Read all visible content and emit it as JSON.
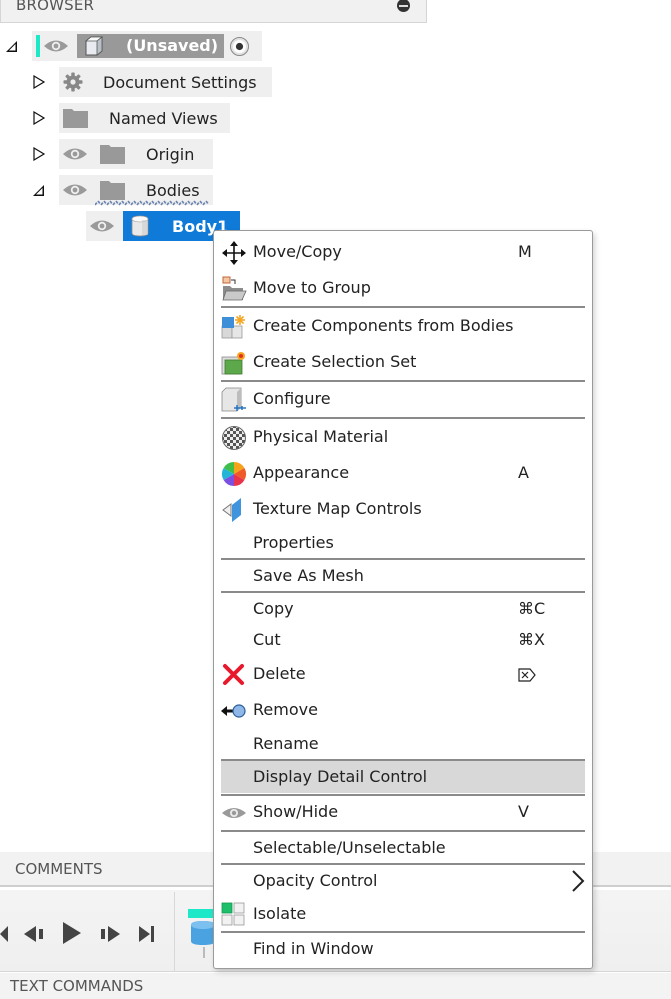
{
  "browser": {
    "title": "BROWSER",
    "tree": [
      {
        "label": "(Unsaved)",
        "expanded": true,
        "level": 0,
        "icon": "component-cube-icon",
        "visible": true,
        "active": true
      },
      {
        "label": "Document Settings",
        "expanded": false,
        "level": 1,
        "icon": "gear-icon"
      },
      {
        "label": "Named Views",
        "expanded": false,
        "level": 1,
        "icon": "folder-icon"
      },
      {
        "label": "Origin",
        "expanded": false,
        "level": 1,
        "icon": "folder-icon",
        "visible": true
      },
      {
        "label": "Bodies",
        "expanded": true,
        "level": 1,
        "icon": "folder-icon",
        "visible": true
      },
      {
        "label": "Body1",
        "level": 2,
        "icon": "body-cylinder-icon",
        "visible": true,
        "selected": true
      }
    ]
  },
  "context_menu": {
    "items": [
      {
        "label": "Move/Copy",
        "shortcut": "M",
        "icon": "move-arrows-icon"
      },
      {
        "label": "Move to Group",
        "shortcut": "",
        "icon": "move-to-group-icon"
      },
      {
        "label": "Create Components from Bodies",
        "shortcut": "",
        "icon": "create-components-icon"
      },
      {
        "label": "Create Selection Set",
        "shortcut": "",
        "icon": "selection-set-icon"
      },
      {
        "label": "Configure",
        "shortcut": "",
        "icon": "configure-icon"
      },
      {
        "label": "Physical Material",
        "shortcut": "",
        "icon": "physical-material-icon"
      },
      {
        "label": "Appearance",
        "shortcut": "A",
        "icon": "appearance-color-wheel-icon"
      },
      {
        "label": "Texture Map Controls",
        "shortcut": "",
        "icon": "texture-map-icon"
      },
      {
        "label": "Properties",
        "shortcut": "",
        "icon": ""
      },
      {
        "label": "Save As Mesh",
        "shortcut": "",
        "icon": ""
      },
      {
        "label": "Copy",
        "shortcut": "⌘C",
        "icon": ""
      },
      {
        "label": "Cut",
        "shortcut": "⌘X",
        "icon": ""
      },
      {
        "label": "Delete",
        "shortcut": "⌦",
        "icon": "delete-x-icon"
      },
      {
        "label": "Remove",
        "shortcut": "",
        "icon": "remove-icon"
      },
      {
        "label": "Rename",
        "shortcut": "",
        "icon": ""
      },
      {
        "label": "Display Detail Control",
        "shortcut": "",
        "icon": "",
        "highlighted": true
      },
      {
        "label": "Show/Hide",
        "shortcut": "V",
        "icon": "eye-icon"
      },
      {
        "label": "Selectable/Unselectable",
        "shortcut": "",
        "icon": ""
      },
      {
        "label": "Opacity Control",
        "shortcut": "",
        "icon": "",
        "submenu": true
      },
      {
        "label": "Isolate",
        "shortcut": "",
        "icon": "isolate-icon"
      },
      {
        "label": "Find in Window",
        "shortcut": "",
        "icon": ""
      }
    ]
  },
  "panels": {
    "comments_title": "COMMENTS",
    "text_commands_title": "TEXT COMMANDS"
  },
  "colors": {
    "selection": "#0f7ad8",
    "accent_teal": "#1de9c8",
    "highlight": "#d8d8d8"
  }
}
